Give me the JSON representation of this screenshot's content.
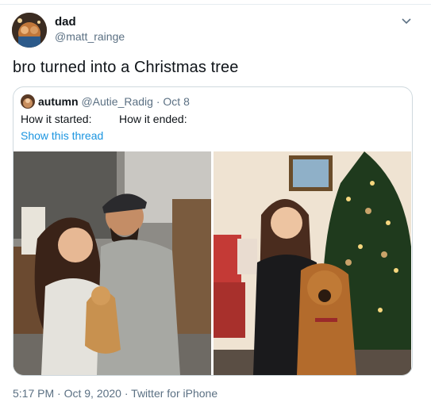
{
  "tweet": {
    "display_name": "dad",
    "handle": "@matt_rainge",
    "text": "bro turned into a Christmas tree",
    "timestamp": "5:17 PM · Oct 9, 2020",
    "separator": " · ",
    "source": "Twitter for iPhone",
    "menu_icon": "chevron-down-icon"
  },
  "quoted": {
    "display_name": "autumn",
    "handle": "@Autie_Radig",
    "date": "· Oct 8",
    "text_left": "How it started:",
    "text_right": "How it ended:",
    "show_thread": "Show this thread"
  },
  "colors": {
    "secondary_text": "#5b7083",
    "link": "#1b95e0",
    "border": "#cfd9de"
  }
}
